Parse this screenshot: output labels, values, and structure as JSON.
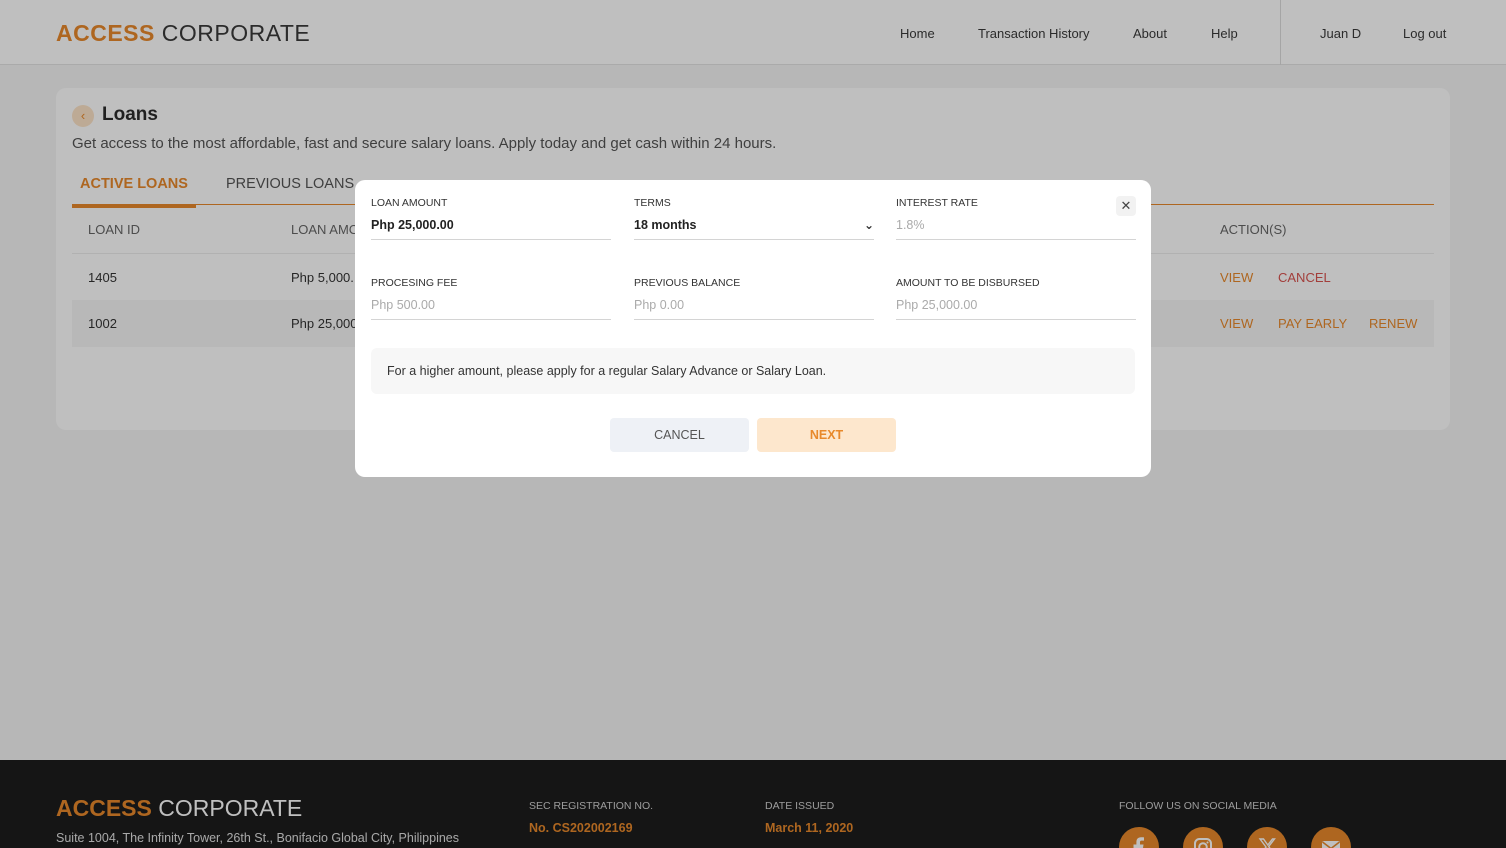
{
  "app": {
    "logo_accent": "ACCESS",
    "logo_main": "CORPORATE"
  },
  "nav": {
    "home": "Home",
    "history": "Transaction History",
    "about": "About",
    "help": "Help",
    "user": "Juan D",
    "logout": "Log out"
  },
  "page": {
    "title": "Loans",
    "subtitle": "Get access to the most affordable, fast and secure salary loans. Apply today and get cash within 24 hours.",
    "back_icon": "chevron-left-icon"
  },
  "tabs": {
    "active": "ACTIVE LOANS",
    "previous": "PREVIOUS LOANS"
  },
  "table": {
    "headers": {
      "loan_id": "LOAN ID",
      "loan_amount": "LOAN AMC",
      "actions": "ACTION(S)"
    },
    "rows": [
      {
        "id": "1405",
        "amount": "Php 5,000.",
        "actions": [
          "VIEW",
          "CANCEL"
        ]
      },
      {
        "id": "1002",
        "amount": "Php 25,000",
        "actions": [
          "VIEW",
          "PAY EARLY",
          "RENEW"
        ]
      }
    ]
  },
  "modal": {
    "loan_amount": {
      "label": "LOAN AMOUNT",
      "value": "Php 25,000.00"
    },
    "terms": {
      "label": "TERMS",
      "value": "18 months"
    },
    "interest_rate": {
      "label": "INTEREST RATE",
      "value": "1.8%"
    },
    "processing_fee": {
      "label": "PROCESING FEE",
      "value": "Php 500.00"
    },
    "previous_balance": {
      "label": "PREVIOUS BALANCE",
      "value": "Php 0.00"
    },
    "disbursed": {
      "label": "AMOUNT TO BE DISBURSED",
      "value": "Php 25,000.00"
    },
    "notice": "For a higher amount, please apply for a regular Salary Advance or Salary Loan.",
    "cancel_label": "CANCEL",
    "next_label": "NEXT",
    "close_icon": "close-icon"
  },
  "footer": {
    "address": "Suite 1004, The Infinity Tower, 26th St., Bonifacio Global City, Philippines",
    "sec_label": "SEC REGISTRATION NO.",
    "sec_value": "No. CS202002169",
    "date_label": "DATE ISSUED",
    "date_value": "March 11, 2020",
    "social_label": "FOLLOW US ON SOCIAL MEDIA",
    "social_icons": [
      "facebook-icon",
      "instagram-icon",
      "x-icon",
      "mail-icon"
    ]
  },
  "colors": {
    "accent": "#e8892b",
    "danger": "#d9534f",
    "footer_bg": "#1d1d1d"
  }
}
